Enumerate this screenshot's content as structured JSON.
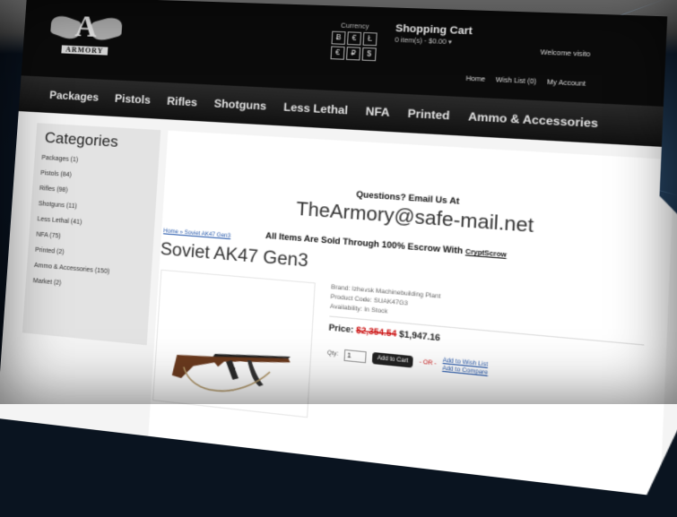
{
  "header": {
    "logo_letter": "A",
    "logo_word": "ARMORY",
    "currency_label": "Currency",
    "currencies": [
      "Ƀ",
      "€",
      "Ł",
      "€",
      "₽",
      "$"
    ],
    "cart_title": "Shopping Cart",
    "cart_summary": "0 item(s) - $0.00",
    "welcome": "Welcome visito",
    "links": [
      "Home",
      "Wish List (0)",
      "My Account"
    ]
  },
  "nav": [
    "Packages",
    "Pistols",
    "Rifles",
    "Shotguns",
    "Less Lethal",
    "NFA",
    "Printed",
    "Ammo & Accessories"
  ],
  "sidebar": {
    "title": "Categories",
    "items": [
      "Packages (1)",
      "Pistols (84)",
      "Rifles (98)",
      "Shotguns (11)",
      "Less Lethal (41)",
      "NFA (75)",
      "Printed (2)",
      "Ammo & Accessories (150)",
      "Market (2)"
    ]
  },
  "main": {
    "questions": "Questions? Email Us At",
    "email": "TheArmory@safe-mail.net",
    "escrow_text": "All Items Are Sold Through 100% Escrow With",
    "escrow_link": "CryptScrow",
    "breadcrumb": "Home » Soviet AK47 Gen3",
    "product_title": "Soviet AK47 Gen3",
    "brand": "Brand: Izhevsk Machinebuilding Plant",
    "product_code": "Product Code: SUAK47G3",
    "availability": "Availability: In Stock",
    "price_label": "Price:",
    "price_old": "$2,354.54",
    "price_new": "$1,947.16",
    "qty_label": "Qty:",
    "qty_value": "1",
    "add_to_cart": "Add to Cart",
    "or": "- OR -",
    "wish_list": "Add to Wish List",
    "compare": "Add to Compare"
  }
}
